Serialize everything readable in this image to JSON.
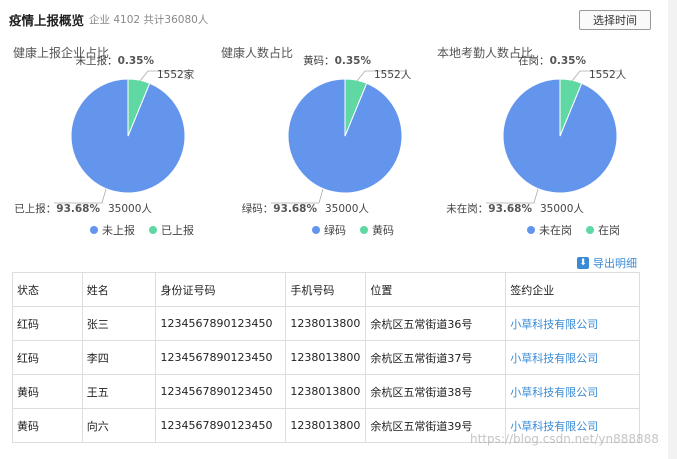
{
  "header": {
    "title": "疫情上报概览",
    "summary": "企业 4102 共计36080人",
    "time_button": "选择时间"
  },
  "colors": {
    "blue": "#6495ed",
    "green": "#5fd8a4"
  },
  "charts": [
    {
      "title": "健康上报企业占比",
      "small_label": "未上报：",
      "small_pct": "0.35%",
      "small_count": "1552家",
      "big_label": "已上报：",
      "big_pct": "93.68%",
      "big_count": "35000人",
      "legend": [
        "未上报",
        "已上报"
      ]
    },
    {
      "title": "健康人数占比",
      "small_label": "黄码：",
      "small_pct": "0.35%",
      "small_count": "1552人",
      "big_label": "绿码：",
      "big_pct": "93.68%",
      "big_count": "35000人",
      "legend": [
        "绿码",
        "黄码"
      ]
    },
    {
      "title": "本地考勤人数占比",
      "small_label": "在岗：",
      "small_pct": "0.35%",
      "small_count": "1552人",
      "big_label": "未在岗：",
      "big_pct": "93.68%",
      "big_count": "35000人",
      "legend": [
        "未在岗",
        "在岗"
      ]
    }
  ],
  "export_label": "导出明细",
  "table": {
    "columns": [
      "状态",
      "姓名",
      "身份证号码",
      "手机号码",
      "位置",
      "签约企业"
    ],
    "rows": [
      [
        "红码",
        "张三",
        "1234567890123450",
        "1238013800",
        "余杭区五常街道36号",
        "小草科技有限公司"
      ],
      [
        "红码",
        "李四",
        "1234567890123450",
        "1238013800",
        "余杭区五常街道37号",
        "小草科技有限公司"
      ],
      [
        "黄码",
        "王五",
        "1234567890123450",
        "1238013800",
        "余杭区五常街道38号",
        "小草科技有限公司"
      ],
      [
        "黄码",
        "向六",
        "1234567890123450",
        "1238013800",
        "余杭区五常街道39号",
        "小草科技有限公司"
      ]
    ]
  },
  "watermark": "https://blog.csdn.net/yn888888"
}
